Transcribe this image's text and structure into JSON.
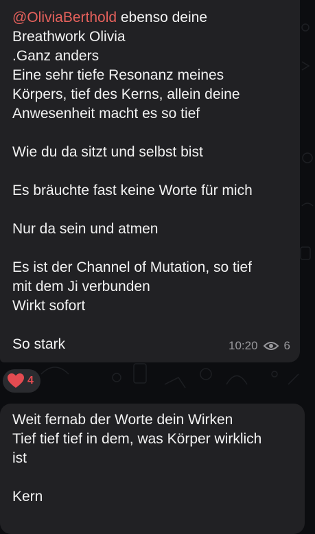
{
  "message1": {
    "mention": "@OliviaBerthold",
    "text": " ebenso deine\nBreathwork Olivia\n.Ganz anders\nEine sehr tiefe Resonanz meines\nKörpers, tief des Kerns, allein deine\nAnwesenheit macht es so tief\n\nWie du da sitzt und selbst bist\n\nEs bräuchte fast keine Worte für mich\n\nNur da sein und atmen\n\nEs ist der Channel of Mutation, so tief\nmit dem Ji verbunden\nWirkt sofort\n\nSo stark",
    "time": "10:20",
    "views": "6",
    "reaction": {
      "emoji": "heart-icon",
      "count": "4"
    }
  },
  "message2": {
    "text": "Weit fernab der Worte dein Wirken\nTief tief tief in dem, was Körper wirklich\nist\n\nKern"
  },
  "colors": {
    "background": "#0c0d10",
    "bubble": "#212124",
    "mention": "#e6615c",
    "meta": "#9a9a9e",
    "reaction": "#e44b51"
  }
}
